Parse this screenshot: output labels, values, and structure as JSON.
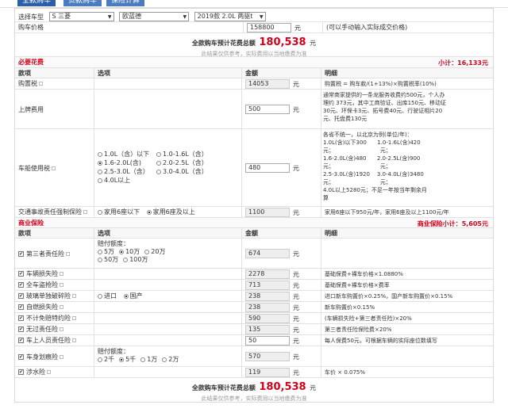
{
  "tabs": [
    "全款购车",
    "贷款购车",
    "保险计算"
  ],
  "select_row": {
    "label": "选择车型",
    "brand": "S 三菱",
    "series": "欧蓝德",
    "model": "2019款 2.0L 两驱t"
  },
  "price_row": {
    "label": "购车价格",
    "value": "158800",
    "unit": "元",
    "tip": "(可以手动输入实际成交价格)"
  },
  "total_top": {
    "label": "全款购车预计花费总额",
    "value": "180,538",
    "unit": "元",
    "note": "此结果仅供参考，实际费用以当地缴费为准"
  },
  "mandatory": {
    "title": "必要花费",
    "subtotal_label": "小计：",
    "subtotal": "16,133元"
  },
  "col_headers": [
    "款项",
    "选项",
    "金额",
    "明细"
  ],
  "tax_row": {
    "label": "购置税",
    "value": "14053",
    "unit": "元",
    "desc": "购置税 = 购车款/(1+13%)×购置税率(10%)"
  },
  "reg_row": {
    "label": "上牌费用",
    "value": "500",
    "unit": "元",
    "desc": [
      "通常商家提供的一条龙服务收费约500元，个人办",
      "理约 373元，其中工商验证、出库150元、移动证",
      "30元、环保卡3元、拓号费40元、行驶证相片20",
      "元、托盘费130元"
    ]
  },
  "vessel_row": {
    "label": "车船使用税",
    "options": [
      "1.0L（含）以下",
      "1.0-1.6L（含）",
      "1.6-2.0L(含)",
      "2.0-2.5L（含）",
      "2.5-3.0L（含）",
      "3.0-4.0L（含）",
      "4.0L以上"
    ],
    "selected": 2,
    "value": "480",
    "unit": "元",
    "desc": [
      "各省不统一，以北京为例(单位/年)：",
      "1.0L(含)以下300      1.0-1.6L(含)420",
      "元；                          元；",
      "1.6-2.0L(含)480      2.0-2.5L(含)900",
      "元；                          元；",
      "2.5-3.0L(含)1920    3.0-4.0L(含)3480",
      "元；                          元；",
      "4.0L以上5280元；不足一年按当年剩余月",
      "算"
    ]
  },
  "compulsory_row": {
    "label": "交通事故责任强制保险",
    "options": [
      "家用6座以下",
      "家用6座及以上"
    ],
    "selected": 1,
    "value": "1100",
    "unit": "元",
    "desc": "家用6座以下950元/年，家用6座及以上1100元/年"
  },
  "commercial": {
    "title": "商业保险",
    "subtotal_label": "商业保险小计：",
    "subtotal": "5,605元"
  },
  "third_party": {
    "label": "第三者责任险",
    "amount_label": "赔付额度：",
    "options": [
      "5万",
      "10万",
      "20万",
      "50万",
      "100万"
    ],
    "selected": 1,
    "value": "674",
    "unit": "元"
  },
  "ins_rows": [
    {
      "label": "车辆损失险",
      "value": "2278",
      "unit": "元",
      "desc": "基础保费+裸车价格×1.0880%"
    },
    {
      "label": "全车盗抢险",
      "value": "713",
      "unit": "元",
      "desc": "基础保费+裸车价格×费率"
    },
    {
      "label": "玻璃单独破碎险",
      "options": [
        "进口",
        "国产"
      ],
      "selected": 1,
      "value": "238",
      "unit": "元",
      "desc": "进口新车购置价×0.25%，国产新车购置价×0.15%"
    },
    {
      "label": "自燃损失险",
      "value": "238",
      "unit": "元",
      "desc": "新车购置价×0.15%"
    },
    {
      "label": "不计免赔特约险",
      "value": "590",
      "unit": "元",
      "desc": "(车辆损失险+第三者责任险)×20%"
    },
    {
      "label": "无过责任险",
      "value": "135",
      "unit": "元",
      "desc": "第三者责任险保险费×20%"
    },
    {
      "label": "车上人员责任险",
      "value": "50",
      "unit": "元",
      "desc": "每人保费50元，可根据车辆的实际座位数填写"
    }
  ],
  "scratch_row": {
    "label": "车身划痕险",
    "amount_label": "赔付额度：",
    "options": [
      "2千",
      "5千",
      "1万",
      "2万"
    ],
    "selected": 1,
    "value": "570",
    "unit": "元"
  },
  "water_row": {
    "label": "涉水险",
    "value": "119",
    "unit": "元",
    "desc": "车价 × 0.075%"
  },
  "total_bottom": {
    "label": "全款购车预计花费总额",
    "value": "180,538",
    "unit": "元",
    "note": "此结果仅供参考，实际费用以当地缴费为准"
  }
}
